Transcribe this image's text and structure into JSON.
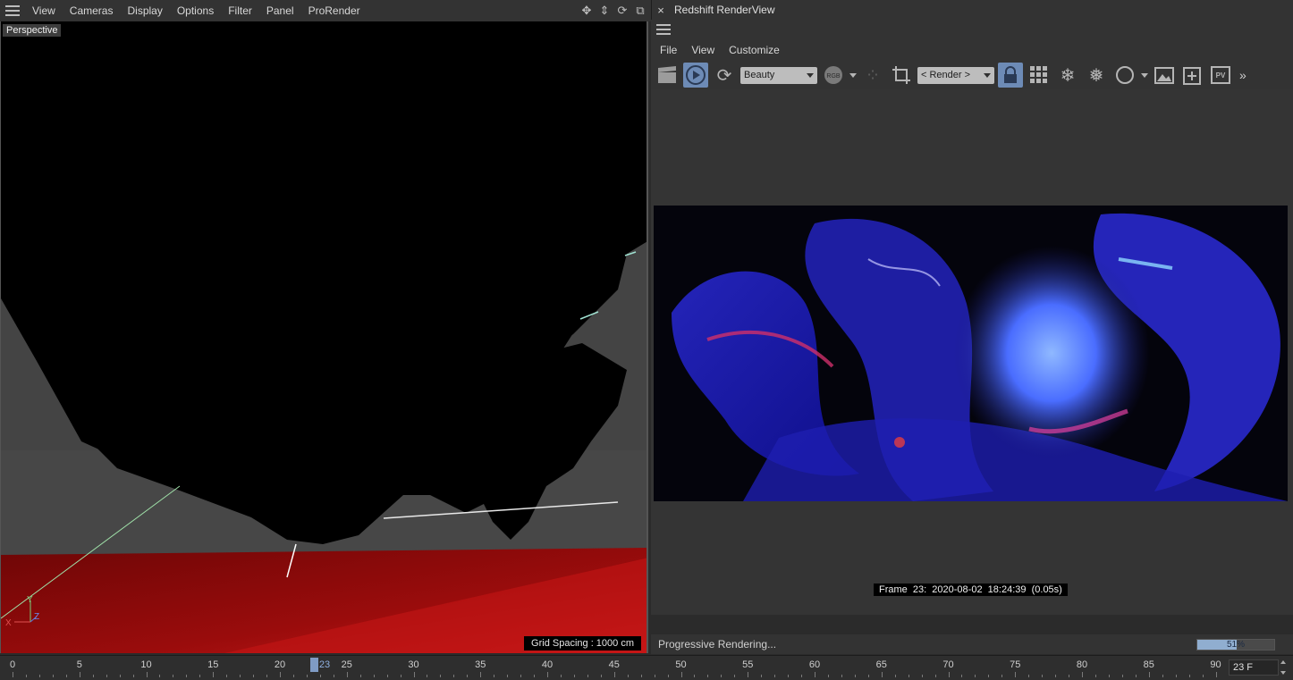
{
  "viewport_menu": {
    "items": [
      "View",
      "Cameras",
      "Display",
      "Options",
      "Filter",
      "Panel",
      "ProRender"
    ]
  },
  "viewport": {
    "label": "Perspective",
    "grid_spacing": "Grid Spacing : 1000 cm",
    "axis": {
      "x": "X",
      "y": "Y",
      "z": "Z"
    }
  },
  "renderview": {
    "title": "Redshift RenderView",
    "close_glyph": "×",
    "menu": [
      "File",
      "View",
      "Customize"
    ],
    "toolbar": {
      "aov_select": "Beauty",
      "rgb_badge": "RGB",
      "camera_select": "< Render >",
      "pv_badge": "PV",
      "overflow": "»"
    },
    "frame_info": "Frame  23:  2020-08-02  18:24:39  (0.05s)",
    "status": "Progressive Rendering...",
    "progress": {
      "percent": 51,
      "label": "51%"
    }
  },
  "timeline": {
    "ticks": [
      "0",
      "5",
      "10",
      "15",
      "20",
      "25",
      "30",
      "35",
      "40",
      "45",
      "50",
      "55",
      "60",
      "65",
      "70",
      "75",
      "80",
      "85",
      "90"
    ],
    "current_frame": "23",
    "frame_field": "23 F"
  },
  "colors": {
    "panel_bg": "#333333",
    "accent": "#6d8bb6",
    "floor_red": "#b01010"
  }
}
